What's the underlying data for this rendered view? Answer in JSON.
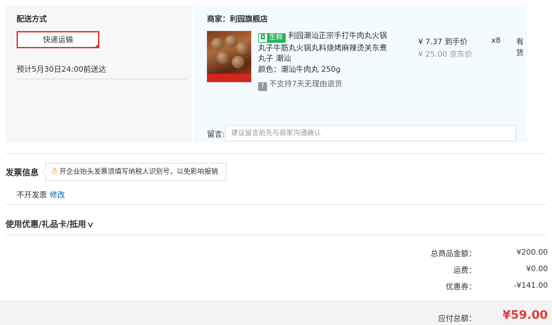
{
  "shipping": {
    "title": "配送方式",
    "method": "快递运输",
    "eta": "预计5月30日24:00前送达"
  },
  "order": {
    "shop": "商家：利园旗舰店",
    "badge_icon": "fresh-icon",
    "badge_text": "生鲜",
    "product_title": "利园潮汕正宗手打牛肉丸火锅丸子牛筋丸火锅丸料烧烤麻辣烫关东煮丸子 潮汕",
    "color": "颜色：潮汕牛肉丸 250g",
    "no_return_icon": "7",
    "no_return": "不支持7天无理由退货",
    "price": "¥ 7.37 到手价",
    "original_price": "¥ 25.00 京东价",
    "qty": "x8",
    "stock": "有货",
    "message_label": "留言:",
    "message_placeholder": "建议留言前先与商家沟通确认"
  },
  "invoice": {
    "title": "发票信息",
    "tip": "开企业抬头发票须填写纳税人识别号，以免影响报销",
    "value": "不开发票",
    "edit": "修改"
  },
  "coupon": {
    "label": "使用优惠/礼品卡/抵用"
  },
  "summary": {
    "rows": [
      {
        "label": "总商品金额：",
        "value": "¥200.00"
      },
      {
        "label": "运费：",
        "value": "¥0.00"
      },
      {
        "label": "优惠券：",
        "value": "-¥141.00"
      }
    ],
    "total_label": "应付总额：",
    "total_value": "¥59.00"
  },
  "colors": {
    "accent": "#e4393c",
    "fresh": "#27b35c",
    "link": "#005ea7"
  }
}
